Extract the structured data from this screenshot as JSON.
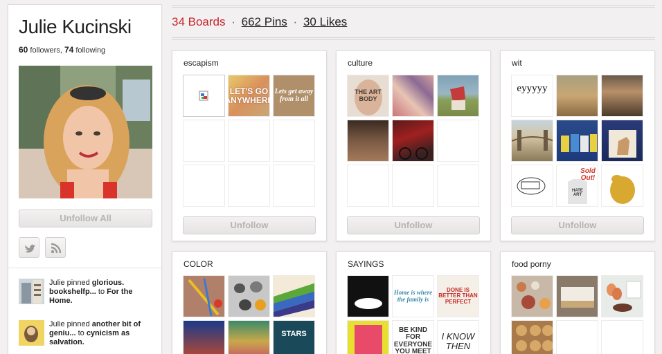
{
  "profile": {
    "name": "Julie Kucinski",
    "followers_count": "60",
    "followers_label": "followers,",
    "following_count": "74",
    "following_label": "following",
    "unfollow_all_label": "Unfollow All"
  },
  "activity": [
    {
      "actor": "Julie pinned",
      "pin": "glorious. bookshelfp...",
      "connector": "to",
      "board": "For the Home."
    },
    {
      "actor": "Julie pinned",
      "pin": "another bit of geniu...",
      "connector": "to",
      "board": "cynicism as salvation."
    }
  ],
  "stats": {
    "boards": "34 Boards",
    "separator": "·",
    "pins": "662 Pins",
    "likes": "30 Likes"
  },
  "boards": [
    {
      "title": "escapism",
      "unfollow_label": "Unfollow",
      "cell_text": [
        "",
        "LET'S GO ANYWHERE",
        "Lets get away from it all"
      ]
    },
    {
      "title": "culture",
      "unfollow_label": "Unfollow",
      "cell_text": [
        "THE ART BODY"
      ]
    },
    {
      "title": "wit",
      "unfollow_label": "Unfollow",
      "cell_text": [
        "eyyyyy",
        "Sold Out!",
        "HATE ART"
      ]
    },
    {
      "title": "COLOR",
      "cell_text": [
        "STARS"
      ]
    },
    {
      "title": "SAYINGS",
      "cell_text": [
        "Home is where the family is",
        "DONE IS BETTER THAN PERFECT",
        "BE KIND FOR EVERYONE YOU MEET",
        "I KNOW THEN"
      ]
    },
    {
      "title": "food porny"
    }
  ],
  "colors": {
    "accent_red": "#c8232c",
    "button_text": "#b7b3b3",
    "background": "#f2f0f0"
  },
  "icons": [
    "twitter-icon",
    "rss-icon",
    "broken-image-icon"
  ]
}
